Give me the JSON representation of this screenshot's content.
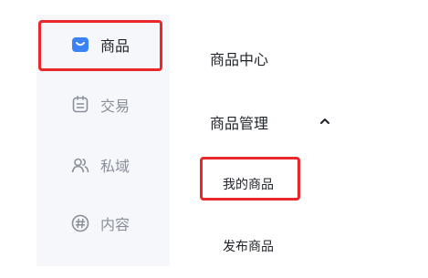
{
  "sidebar": {
    "items": [
      {
        "label": "商品",
        "icon": "bag-icon",
        "active": true
      },
      {
        "label": "交易",
        "icon": "receipt-icon",
        "active": false
      },
      {
        "label": "私域",
        "icon": "users-icon",
        "active": false
      },
      {
        "label": "内容",
        "icon": "hashtag-icon",
        "active": false
      }
    ]
  },
  "submenu": {
    "center_label": "商品中心",
    "manage_label": "商品管理",
    "manage_icon": "chevron-up-icon",
    "items": [
      {
        "label": "我的商品",
        "highlighted": true
      },
      {
        "label": "发布商品",
        "highlighted": false
      }
    ]
  },
  "colors": {
    "accent": "#3b82f6",
    "highlight_border": "#e8282b",
    "sidebar_bg": "#f5f7fa",
    "inactive_text": "#8a8f99",
    "active_text": "#1f2329"
  }
}
